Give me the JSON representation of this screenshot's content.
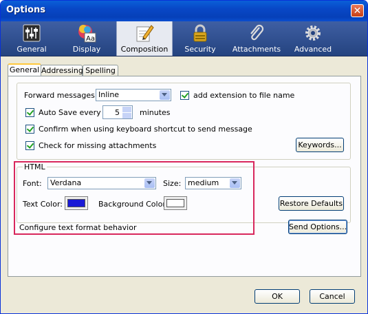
{
  "window": {
    "title": "Options",
    "close_glyph": "✕"
  },
  "toolbar": [
    {
      "label": "General",
      "icon": "sliders-icon"
    },
    {
      "label": "Display",
      "icon": "display-icon"
    },
    {
      "label": "Composition",
      "icon": "pencil-paper-icon",
      "selected": true
    },
    {
      "label": "Security",
      "icon": "lock-icon"
    },
    {
      "label": "Attachments",
      "icon": "paperclip-icon"
    },
    {
      "label": "Advanced",
      "icon": "gear-icon"
    }
  ],
  "tabs": [
    {
      "label": "General",
      "active": true
    },
    {
      "label": "Addressing"
    },
    {
      "label": "Spelling"
    }
  ],
  "general": {
    "forward_label": "Forward messages:",
    "forward_value": "Inline",
    "add_extension_label": "add extension to file name",
    "autosave_label": "Auto Save every",
    "autosave_value": "5",
    "autosave_unit": "minutes",
    "confirm_label": "Confirm when using keyboard shortcut to send message",
    "check_missing_label": "Check for missing attachments",
    "keywords_button": "Keywords..."
  },
  "html_group": {
    "legend": "HTML",
    "font_label": "Font:",
    "font_value": "Verdana",
    "size_label": "Size:",
    "size_value": "medium",
    "text_color_label": "Text Color:",
    "text_color": "#1a1ad6",
    "bg_color_label": "Background Color:",
    "bg_color": "#ffffff",
    "restore_button": "Restore Defaults"
  },
  "configure_text": "Configure text format behavior",
  "send_options_button": "Send Options...",
  "footer": {
    "ok": "OK",
    "cancel": "Cancel"
  },
  "colors": {
    "highlight": "#d8265c",
    "titlebar": "#0a5fd8"
  }
}
